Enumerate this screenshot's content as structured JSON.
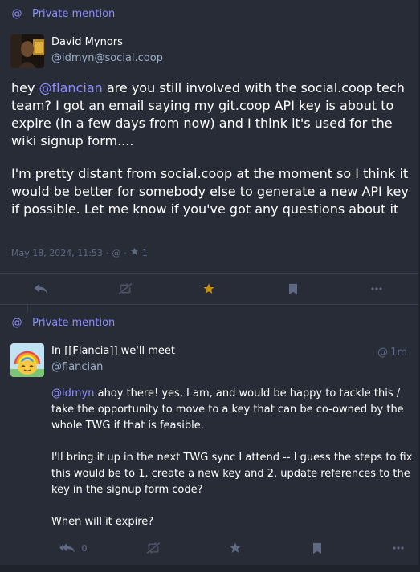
{
  "colors": {
    "background": "#282c37",
    "accent": "#8c8dff",
    "muted": "#606984",
    "handle": "#9baec8",
    "star_active": "#ca8f04",
    "icon": "#606984"
  },
  "post1": {
    "visibility_label": "Private mention",
    "visibility_icon": "at-icon",
    "author": {
      "display_name": "David Mynors",
      "handle": "@idmyn@social.coop"
    },
    "content": {
      "p1_pre": "hey ",
      "p1_mention": "@flancian",
      "p1_post": " are you still involved with the social.coop tech team? I got an email saying my git.coop API key is about to expire (in a few days from now) and I think it's used for the wiki signup form....",
      "p2": "I'm pretty distant from social.coop at the moment so I think it would be better for somebody else to generate a new API key if possible. Let me know if you've got any questions about it"
    },
    "meta": {
      "timestamp": "May 18, 2024, 11:53",
      "sep1": "·",
      "visibility_glyph": "@",
      "sep2": "·",
      "favourites": "1"
    },
    "actions": [
      {
        "name": "reply",
        "icon": "reply-icon"
      },
      {
        "name": "boost",
        "icon": "boost-disabled-icon"
      },
      {
        "name": "favourite",
        "icon": "star-icon",
        "active": true
      },
      {
        "name": "bookmark",
        "icon": "bookmark-icon"
      },
      {
        "name": "more",
        "icon": "ellipsis-icon"
      }
    ]
  },
  "post2": {
    "visibility_label": "Private mention",
    "visibility_icon": "at-icon",
    "author": {
      "display_name": "In [[Flancia]] we'll meet",
      "handle": "@flancian"
    },
    "time": {
      "glyph": "@",
      "relative": "1m"
    },
    "content": {
      "p1_mention": "@idmyn",
      "p1_post": " ahoy there! yes, I am, and would be happy to tackle this / take the opportunity to move to a key that can be co-owned by the whole TWG if that is feasible.",
      "p2": "I'll bring it up in the next TWG sync I attend -- I guess the steps to fix this would be to 1. create a new key and 2. update references to the key in the signup form code?",
      "p3": "When will it expire?"
    },
    "reply_count": "0",
    "actions": [
      {
        "name": "reply-all",
        "icon": "reply-all-icon"
      },
      {
        "name": "boost",
        "icon": "boost-disabled-icon"
      },
      {
        "name": "favourite",
        "icon": "star-icon",
        "active": false
      },
      {
        "name": "bookmark",
        "icon": "bookmark-icon"
      },
      {
        "name": "more",
        "icon": "ellipsis-icon"
      }
    ]
  }
}
